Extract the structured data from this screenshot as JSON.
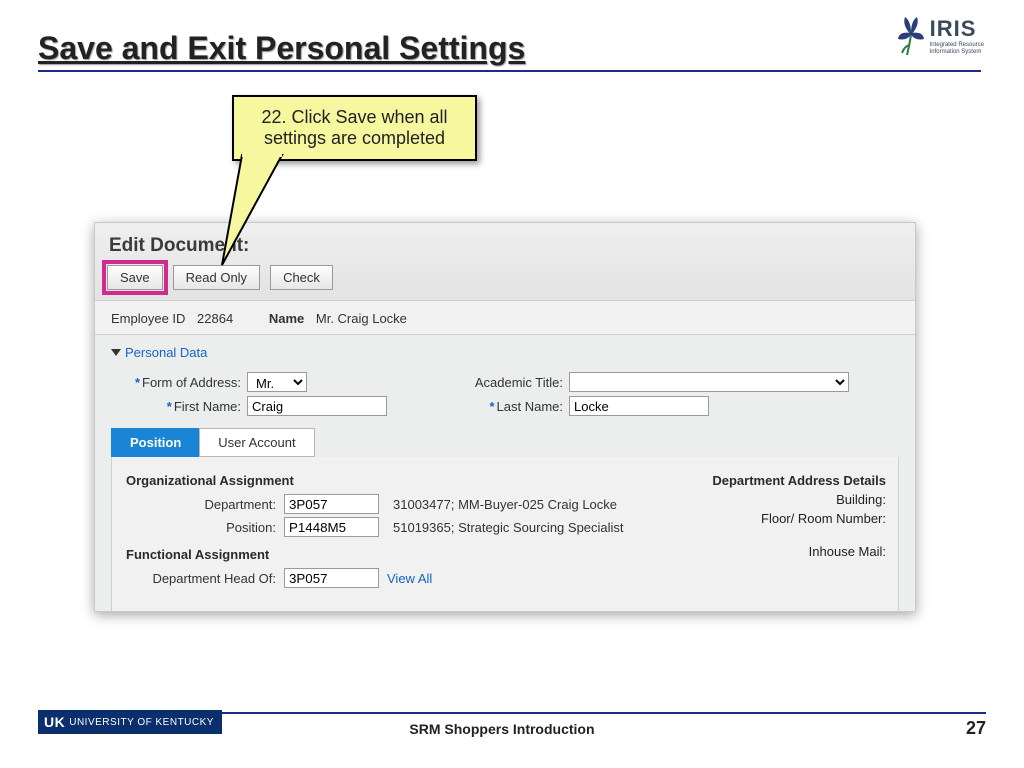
{
  "slide": {
    "title": "Save and Exit Personal Settings",
    "callout": "22. Click Save when all settings are completed",
    "footer_title": "SRM Shoppers Introduction",
    "page_number": "27",
    "uk_label": "UNIVERSITY OF KENTUCKY",
    "uk_mark": "UK"
  },
  "iris": {
    "name": "IRIS",
    "sub1": "Integrated Resource",
    "sub2": "Information System"
  },
  "panel": {
    "title": "Edit Document:",
    "buttons": {
      "save": "Save",
      "read_only": "Read Only",
      "check": "Check"
    },
    "employee": {
      "id_label": "Employee ID",
      "id_value": "22864",
      "name_label": "Name",
      "name_value": "Mr. Craig Locke"
    },
    "section_link": "Personal Data",
    "form": {
      "form_of_address_label": "Form of Address:",
      "form_of_address_value": "Mr.",
      "academic_title_label": "Academic Title:",
      "academic_title_value": "",
      "first_name_label": "First Name:",
      "first_name_value": "Craig",
      "last_name_label": "Last Name:",
      "last_name_value": "Locke"
    },
    "tabs": {
      "position": "Position",
      "user_account": "User Account"
    },
    "org": {
      "heading": "Organizational Assignment",
      "department_label": "Department:",
      "department_value": "3P057",
      "department_desc": "31003477; MM-Buyer-025 Craig Locke",
      "position_label": "Position:",
      "position_value": "P1448M5",
      "position_desc": "51019365; Strategic Sourcing Specialist"
    },
    "func": {
      "heading": "Functional Assignment",
      "dept_head_label": "Department Head Of:",
      "dept_head_value": "3P057",
      "view_all": "View All"
    },
    "addr": {
      "heading": "Department Address Details",
      "building": "Building:",
      "floor": "Floor/ Room Number:",
      "mail": "Inhouse Mail:"
    }
  }
}
